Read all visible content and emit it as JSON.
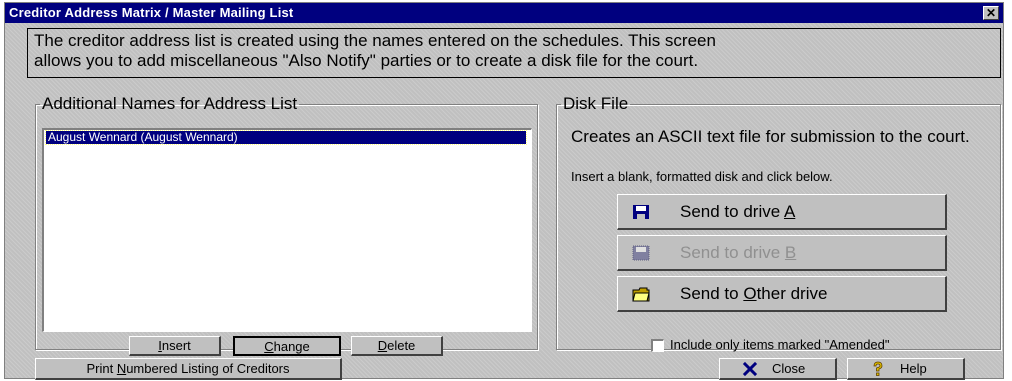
{
  "window": {
    "title": "Creditor Address Matrix / Master Mailing List",
    "close_glyph": "✕"
  },
  "info": {
    "line1": "The creditor address list is created using the names entered on the schedules.  This screen",
    "line2": "allows you to add miscellaneous \"Also Notify\" parties or to create a disk file for the court."
  },
  "names_group": {
    "legend": "Additional Names for Address List",
    "items": [
      "August Wennard (August Wennard)"
    ],
    "buttons": {
      "insert_pre": "",
      "insert_key": "I",
      "insert_post": "nsert",
      "change_pre": "",
      "change_key": "C",
      "change_post": "hange",
      "delete_pre": "",
      "delete_key": "D",
      "delete_post": "elete"
    }
  },
  "disk_group": {
    "legend": "Disk File",
    "description": "Creates an ASCII text file for submission to the court.",
    "instruction": "Insert a blank, formatted disk and click below.",
    "drive_a_pre": "Send to drive ",
    "drive_a_key": "A",
    "drive_b_pre": "Send to drive ",
    "drive_b_key": "B",
    "drive_other_pre": "Send to ",
    "drive_other_key": "O",
    "drive_other_post": "ther drive",
    "amended_label": "Include only items marked \"Amended\"",
    "amended_checked": false
  },
  "footer": {
    "print_pre": "Print ",
    "print_key": "N",
    "print_post": "umbered Listing of Creditors",
    "close_label": "Close",
    "help_label": "Help"
  },
  "icons": {
    "floppy_a": "floppy-disk-icon",
    "floppy_b": "floppy-disk-disabled-icon",
    "folder": "folder-icon",
    "close": "x-icon",
    "help": "question-mark-icon"
  },
  "colors": {
    "titlebar": "#00007f",
    "face": "#c0c0c0",
    "selection": "#00007f",
    "close_icon": "#00007f",
    "help_icon": "#e0c000"
  }
}
